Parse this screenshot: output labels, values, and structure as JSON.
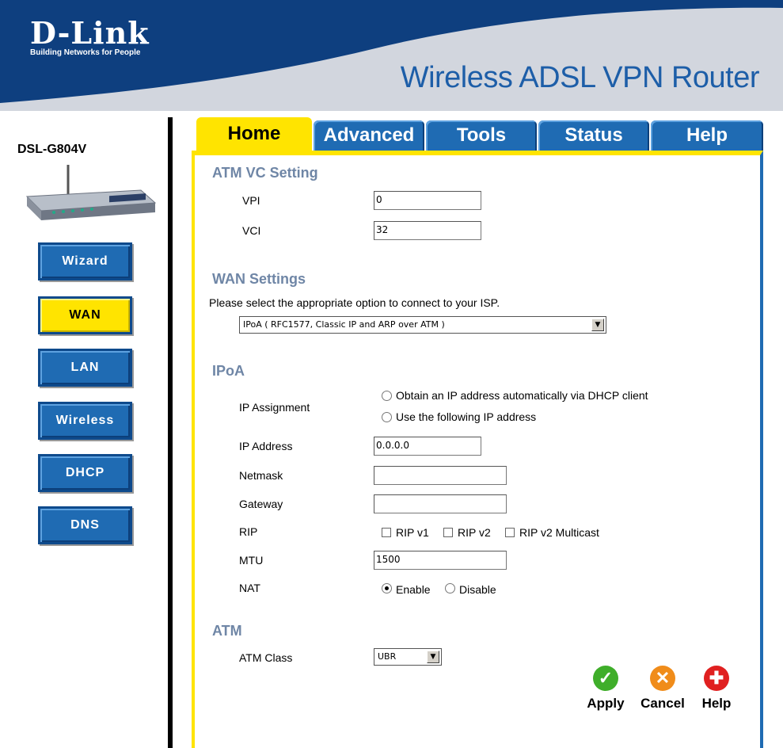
{
  "header": {
    "logo": "D-Link",
    "tagline": "Building Networks for People",
    "product_title": "Wireless ADSL VPN Router"
  },
  "device": {
    "model": "DSL-G804V"
  },
  "sidebar": {
    "buttons": [
      {
        "label": "Wizard",
        "active": false
      },
      {
        "label": "WAN",
        "active": true
      },
      {
        "label": "LAN",
        "active": false
      },
      {
        "label": "Wireless",
        "active": false
      },
      {
        "label": "DHCP",
        "active": false
      },
      {
        "label": "DNS",
        "active": false
      }
    ]
  },
  "tabs": [
    {
      "label": "Home",
      "active": true
    },
    {
      "label": "Advanced",
      "active": false
    },
    {
      "label": "Tools",
      "active": false
    },
    {
      "label": "Status",
      "active": false
    },
    {
      "label": "Help",
      "active": false
    }
  ],
  "atm_vc": {
    "title": "ATM VC Setting",
    "vpi_label": "VPI",
    "vpi_value": "0",
    "vci_label": "VCI",
    "vci_value": "32"
  },
  "wan": {
    "title": "WAN Settings",
    "prompt": "Please select the appropriate option to connect to your ISP.",
    "connection_type": "IPoA ( RFC1577, Classic IP and ARP over ATM )"
  },
  "ipoa": {
    "title": "IPoA",
    "ip_assignment_label": "IP Assignment",
    "option_dhcp": "Obtain an IP address automatically via DHCP client",
    "option_static": "Use the following IP address",
    "ip_address_label": "IP Address",
    "ip_address_value": "0.0.0.0",
    "netmask_label": "Netmask",
    "netmask_value": "",
    "gateway_label": "Gateway",
    "gateway_value": "",
    "rip_label": "RIP",
    "rip_v1": "RIP v1",
    "rip_v2": "RIP v2",
    "rip_v2_multicast": "RIP v2 Multicast",
    "mtu_label": "MTU",
    "mtu_value": "1500",
    "nat_label": "NAT",
    "nat_enable": "Enable",
    "nat_disable": "Disable",
    "nat_selected": "Enable"
  },
  "atm": {
    "title": "ATM",
    "class_label": "ATM Class",
    "class_value": "UBR"
  },
  "actions": {
    "apply": "Apply",
    "cancel": "Cancel",
    "help": "Help"
  },
  "colors": {
    "nav_blue": "#1f6bb3",
    "active_yellow": "#ffe400",
    "header_dark_blue": "#0e3f7f",
    "header_gray": "#d2d6de",
    "section_title": "#6f86a6",
    "apply_green": "#3fae2a",
    "cancel_orange": "#f08c1a",
    "help_red": "#e02020"
  }
}
